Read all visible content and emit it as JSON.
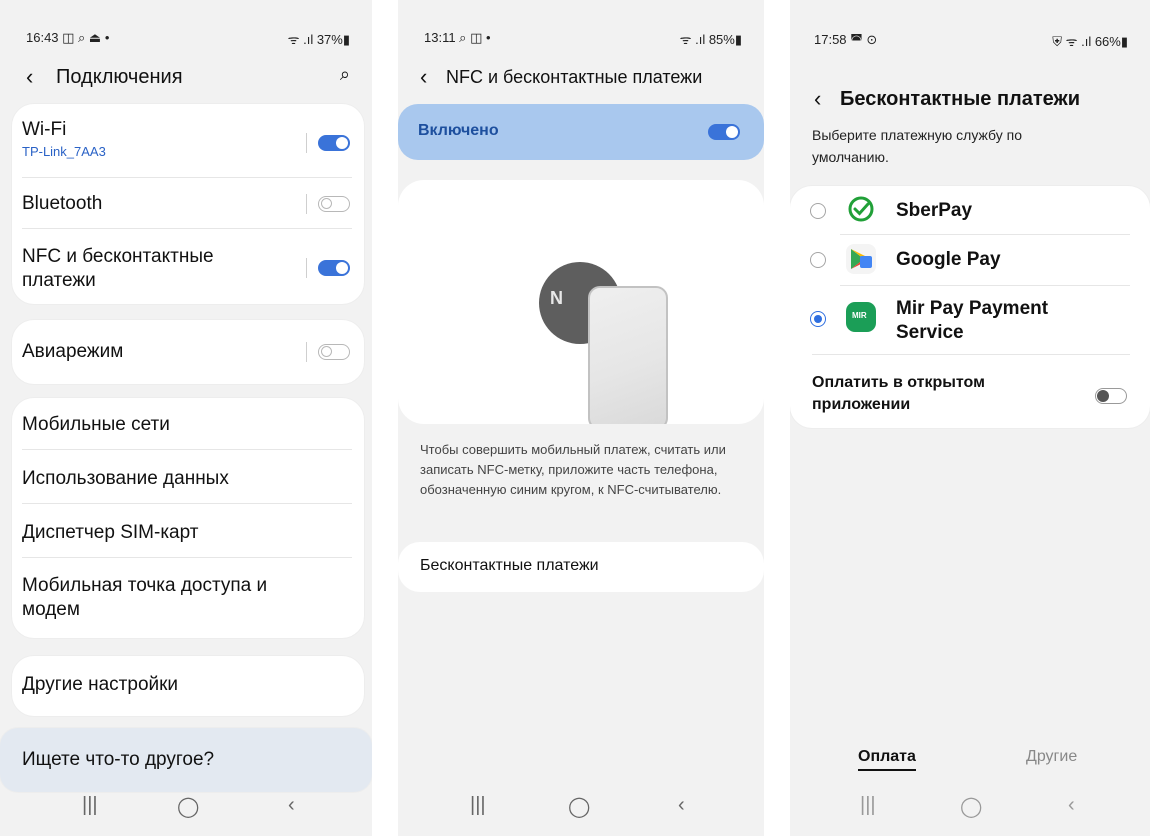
{
  "screen1": {
    "status": {
      "time": "16:43 ◫ ⌕ ⏏ •",
      "right": "ᯤ .ıl 37%▮"
    },
    "header": {
      "back": "‹",
      "title": "Подключения",
      "search": "⌕"
    },
    "items": [
      {
        "label": "Wi-Fi",
        "sub": "TP-Link_7AA3"
      },
      {
        "label": "Bluetooth"
      },
      {
        "label": "NFC и бесконтактные платежи"
      },
      {
        "label": "Авиарежим"
      },
      {
        "label": "Мобильные сети"
      },
      {
        "label": "Использование данных"
      },
      {
        "label": "Диспетчер SIM-карт"
      },
      {
        "label": "Мобильная точка доступа и модем"
      },
      {
        "label": "Другие настройки"
      },
      {
        "label": "Ищете что-то другое?"
      }
    ],
    "nav": {
      "recent": "|||",
      "home": "◯",
      "back": "‹"
    }
  },
  "screen2": {
    "status": {
      "time": "13:11 ⌕ ◫ •",
      "right": "ᯤ .ıl 85%▮"
    },
    "header": {
      "back": "‹",
      "title": "NFC и бесконтактные платежи"
    },
    "enabled_label": "Включено",
    "nfc_symbol": "N",
    "info_text": "Чтобы совершить мобильный платеж, считать или записать NFC-метку, приложите часть телефона, обозначенную синим кругом, к NFC-считывателю.",
    "payments_link": "Бесконтактные платежи",
    "nav": {
      "recent": "|||",
      "home": "◯",
      "back": "‹"
    }
  },
  "screen3": {
    "status": {
      "time": "17:58 ◚ ⊙",
      "right": "⛨ ᯤ .ıl 66%▮"
    },
    "header": {
      "back": "‹",
      "title": "Бесконтактные платежи"
    },
    "subtitle": "Выберите платежную службу по умолчанию.",
    "services": [
      {
        "name": "SberPay",
        "selected": false,
        "icon": "sberpay-icon",
        "color": "#21a038"
      },
      {
        "name": "Google Pay",
        "selected": false,
        "icon": "google-pay-icon",
        "color": "#4285f4"
      },
      {
        "name": "Mir Pay Payment Service",
        "selected": true,
        "icon": "mir-pay-icon",
        "color": "#1b9e57"
      }
    ],
    "mir_icon_text": "MIR",
    "open_app_label": "Оплатить в открытом приложении",
    "tabs": [
      "Оплата",
      "Другие"
    ],
    "nav": {
      "recent": "|||",
      "home": "◯",
      "back": "‹"
    }
  },
  "colors": {
    "accent": "#3a73d9",
    "enabled_bg": "#a9c8ee",
    "link_blue": "#2a62c6"
  }
}
